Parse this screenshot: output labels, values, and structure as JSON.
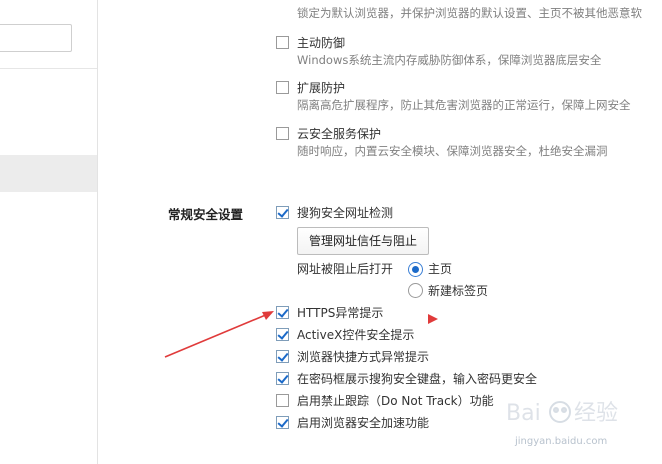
{
  "top_item": {
    "desc": "锁定为默认浏览器，并保护浏览器的默认设置、主页不被其他恶意软"
  },
  "protections": [
    {
      "label": "主动防御",
      "desc": "Windows系统主流内存威胁防御体系，保障浏览器底层安全",
      "checked": false
    },
    {
      "label": "扩展防护",
      "desc": "隔离高危扩展程序，防止其危害浏览器的正常运行，保障上网安全",
      "checked": false
    },
    {
      "label": "云安全服务保护",
      "desc": "随时响应，内置云安全模块、保障浏览器安全，杜绝安全漏洞",
      "checked": false
    }
  ],
  "general": {
    "section_title": "常规安全设置",
    "url_check_label": "搜狗安全网址检测",
    "manage_button": "管理网址信任与阻止",
    "redirect_label": "网址被阻止后打开",
    "radio_home": "主页",
    "radio_newtab": "新建标签页",
    "options": [
      {
        "label": "HTTPS异常提示",
        "checked": true
      },
      {
        "label": "ActiveX控件安全提示",
        "checked": true
      },
      {
        "label": "浏览器快捷方式异常提示",
        "checked": true
      },
      {
        "label": "在密码框展示搜狗安全键盘，输入密码更安全",
        "checked": true
      },
      {
        "label": "启用禁止跟踪（Do Not Track）功能",
        "checked": false
      },
      {
        "label": "启用浏览器安全加速功能",
        "checked": true
      }
    ]
  },
  "watermark": {
    "text": "jingyan.baidu.com"
  },
  "colors": {
    "annotation_arrow": "#e03b3b",
    "accent": "#1b6ac9"
  }
}
